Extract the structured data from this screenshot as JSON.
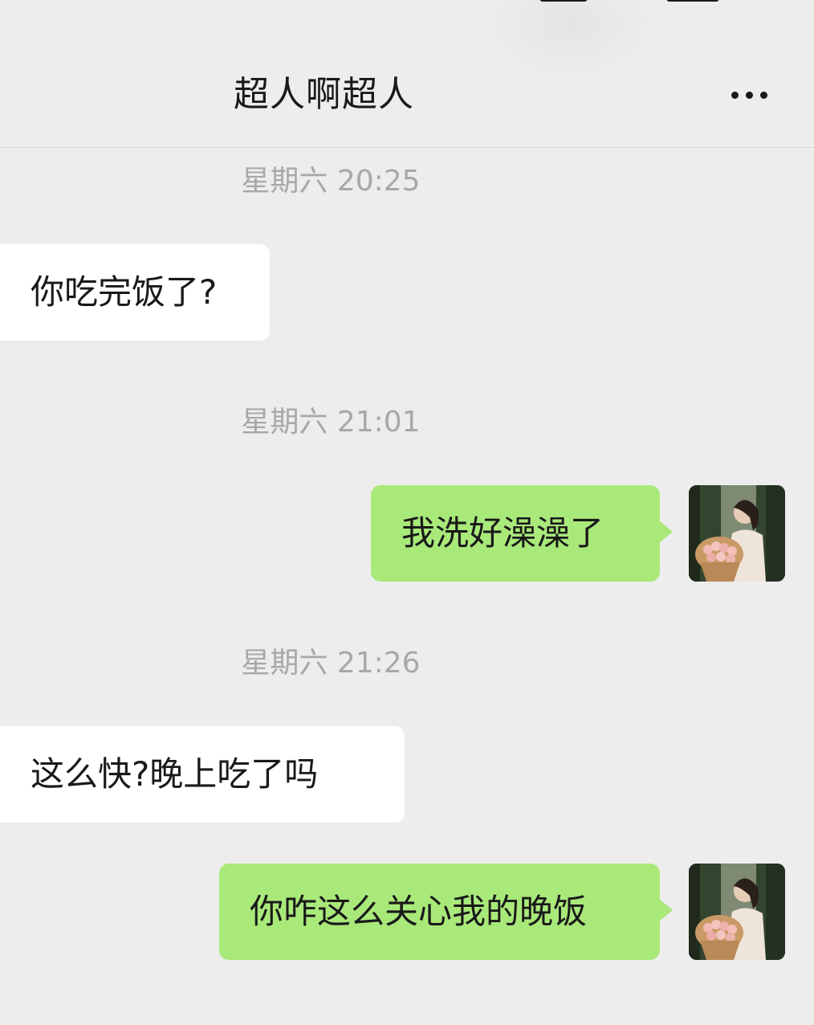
{
  "header": {
    "title": "超人啊超人",
    "more_icon": "more-dots-icon"
  },
  "messages": [
    {
      "type": "time",
      "text": "星期六 20:25"
    },
    {
      "type": "received",
      "text": "你吃完饭了?"
    },
    {
      "type": "time",
      "text": "星期六 21:01"
    },
    {
      "type": "sent",
      "text": "我洗好澡澡了",
      "avatar": "avatar-woman-with-roses-photo"
    },
    {
      "type": "time",
      "text": "星期六 21:26"
    },
    {
      "type": "received",
      "text": "这么快?晚上吃了吗"
    },
    {
      "type": "sent",
      "text": "你咋这么关心我的晚饭",
      "avatar": "avatar-woman-with-roses-photo"
    }
  ],
  "colors": {
    "background": "#ededed",
    "received_bubble": "#ffffff",
    "sent_bubble": "#a9e97a",
    "timestamp_text": "#a8a8a8",
    "primary_text": "#191919"
  }
}
